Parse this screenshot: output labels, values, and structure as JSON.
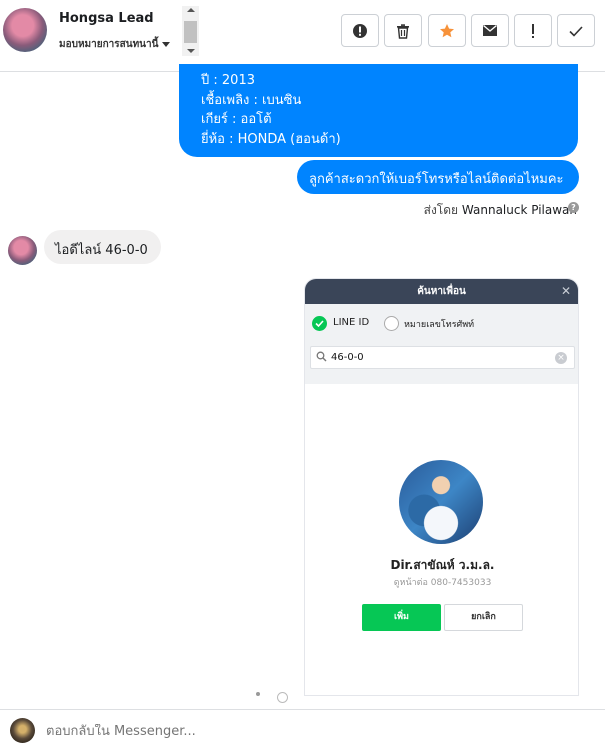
{
  "conversation": {
    "contact_name": "Hongsa Lead",
    "contact_status": "มอบหมายการสนทนานี้"
  },
  "toolbar": [
    {
      "name": "report-button",
      "icon": "exclamation-circle-icon",
      "label": ""
    },
    {
      "name": "delete-button",
      "icon": "trash-icon",
      "label": ""
    },
    {
      "name": "star-button",
      "icon": "star-icon",
      "label": ""
    },
    {
      "name": "mark-unread-button",
      "icon": "envelope-icon",
      "label": ""
    },
    {
      "name": "flag-button",
      "icon": "exclamation-icon",
      "label": ""
    },
    {
      "name": "done-button",
      "icon": "check-icon",
      "label": ""
    }
  ],
  "messages": {
    "outgoing_1_lines": [
      "ปี : 2013",
      "เชื้อเพลิง : เบนซิน",
      "เกียร์ : ออโต้",
      "ยี่ห้อ : HONDA (ฮอนด้า)"
    ],
    "outgoing_2": "ลูกค้าสะดวกให้เบอร์โทรหรือไลน์ติดต่อไหมคะ",
    "sent_by_prefix": "ส่งโดย",
    "sent_by_name": "Wannaluck Pilawan",
    "incoming_1": "ไอดีไลน์ 46-0-0"
  },
  "line_screenshot": {
    "title": "ค้นหาเพื่อน",
    "option_selected": "LINE ID",
    "option_other": "หมายเลขโทรศัพท์",
    "search_value": "46-0-0",
    "profile_name": "Dir.สาขัณห์ ว.ม.ล.",
    "profile_status": "ดูหน้าต่อ 080-7453033",
    "add_button": "เพิ่ม",
    "cancel_button": "ยกเลิก"
  },
  "composer": {
    "placeholder": "ตอบกลับใน Messenger..."
  },
  "colors": {
    "outgoing_bubble": "#0084ff",
    "incoming_bubble": "#f1f0f0",
    "star_accent": "#f7923a",
    "line_green": "#06c755",
    "line_header": "#3a4558"
  }
}
